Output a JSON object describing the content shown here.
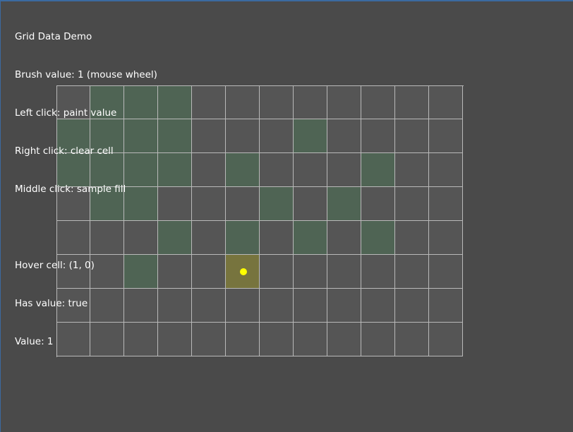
{
  "hud": {
    "title": "Grid Data Demo",
    "brush": "Brush value: 1 (mouse wheel)",
    "left_click": "Left click: paint value",
    "right_click": "Right click: clear cell",
    "middle_click": "Middle click: sample fill",
    "hover_cell": "Hover cell: (1, 0)",
    "has_value": "Has value: true",
    "value": "Value: 1"
  },
  "grid": {
    "columns": 12,
    "rows": 8,
    "filled_cells": [
      [
        0,
        1
      ],
      [
        0,
        2
      ],
      [
        0,
        3
      ],
      [
        1,
        0
      ],
      [
        1,
        1
      ],
      [
        1,
        2
      ],
      [
        1,
        3
      ],
      [
        1,
        7
      ],
      [
        2,
        0
      ],
      [
        2,
        1
      ],
      [
        2,
        2
      ],
      [
        2,
        3
      ],
      [
        2,
        5
      ],
      [
        2,
        9
      ],
      [
        3,
        1
      ],
      [
        3,
        2
      ],
      [
        3,
        6
      ],
      [
        3,
        8
      ],
      [
        4,
        3
      ],
      [
        4,
        5
      ],
      [
        4,
        7
      ],
      [
        4,
        9
      ],
      [
        5,
        2
      ]
    ],
    "hover_cell": [
      5,
      5
    ]
  },
  "colors": {
    "background": "#4a4a4a",
    "cell_empty": "#555555",
    "cell_filled": "#4f6454",
    "cell_hover": "#77743e",
    "grid_line": "#b9b9b9",
    "cursor": "#ffff00"
  }
}
